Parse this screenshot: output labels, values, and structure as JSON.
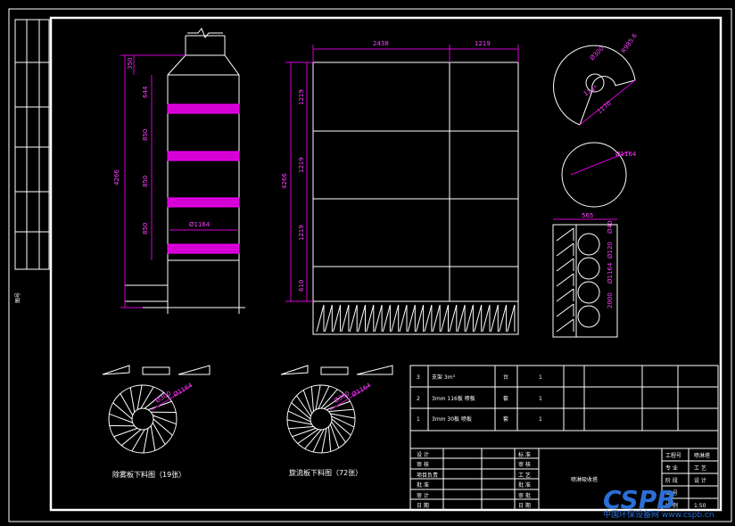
{
  "tower": {
    "dim_left_total": "4266",
    "dim_top": "350",
    "dims_right": [
      "644",
      "850",
      "850",
      "850"
    ],
    "diameter": "Ø1164"
  },
  "panel": {
    "width_a": "2438",
    "width_b": "1219",
    "height_total": "4266",
    "heights": [
      "1219",
      "1219",
      "1219",
      "610"
    ]
  },
  "cone": {
    "dia_top": "Ø300",
    "radius": "R985.6",
    "angle": "114°",
    "width": "1170"
  },
  "circle": {
    "dia": "Ø1164"
  },
  "plate": {
    "width": "565",
    "labels": [
      "Ø40",
      "Ø120",
      "Ø1164",
      "2000"
    ]
  },
  "fan_left": {
    "dia_a": "Ø300",
    "dia_b": "Ø1164",
    "caption": "除雾板下料图（19张）"
  },
  "fan_right": {
    "dia_a": "Ø300",
    "dia_b": "Ø1164",
    "caption": "旋流板下料图（72张）"
  },
  "left_strip": {
    "label": "图号"
  },
  "bom": {
    "rows": [
      {
        "no": "3",
        "name": "支架 3m³",
        "unit": "台",
        "qty": "1"
      },
      {
        "no": "2",
        "name": "3mm 116板 喷板",
        "unit": "套",
        "qty": "1"
      },
      {
        "no": "1",
        "name": "3mm 30板 喷板",
        "unit": "套",
        "qty": "1"
      }
    ]
  },
  "title_block": {
    "left_labels": [
      "设 计",
      "审 核",
      "项目负责",
      "批 准",
      "审 计",
      "日 期"
    ],
    "mid_labels": [
      "标 准",
      "审 核",
      "工 艺",
      "批 准",
      "审 批",
      "日 期"
    ],
    "drawing_name": "喷淋吸收塔",
    "right_labels": [
      [
        "工程号",
        "喷淋塔"
      ],
      [
        "专 业",
        "工 艺"
      ],
      [
        "阶 段",
        "设 计"
      ],
      [
        "图 号",
        ""
      ],
      [
        "比 例",
        "1:50"
      ]
    ]
  },
  "watermark": {
    "logo": "CSPB",
    "sub": "中国环保设备网 www.cspb.cn"
  }
}
